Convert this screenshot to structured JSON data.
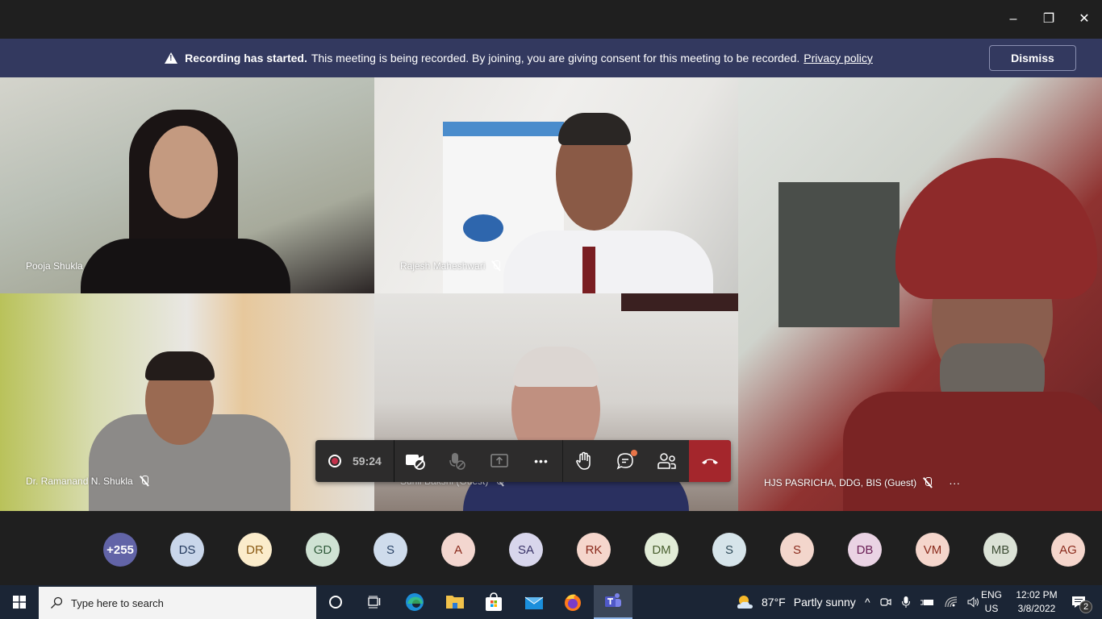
{
  "window": {
    "controls": {
      "minimize": "–",
      "restore": "❐",
      "close": "✕"
    }
  },
  "banner": {
    "icon": "warning-icon",
    "bold": "Recording has started.",
    "text": "This meeting is being recorded. By joining, you are giving consent for this meeting to be recorded.",
    "link": "Privacy policy",
    "dismiss": "Dismiss"
  },
  "participants": [
    {
      "name": "Pooja Shukla",
      "muted": false
    },
    {
      "name": "Rajesh Maheshwari",
      "muted": true
    },
    {
      "name": "Dr. Ramanand N. Shukla",
      "muted": true
    },
    {
      "name": "Sunil Bakshi (Guest)",
      "muted": true
    },
    {
      "name": "HJS PASRICHA, DDG, BIS (Guest)",
      "muted": true,
      "more": "···"
    }
  ],
  "toolbar": {
    "recording": true,
    "timer": "59:24",
    "buttons": [
      "camera-off",
      "mic-off",
      "share-screen",
      "more-actions",
      "raise-hand",
      "chat",
      "participants",
      "leave"
    ],
    "more_label": "•••",
    "chat_unread": true
  },
  "roster": {
    "overflow": {
      "label": "+255",
      "bg": "#6264a7",
      "fg": "#ffffff"
    },
    "avatars": [
      {
        "initials": "DS",
        "bg": "#c9d6ea",
        "fg": "#243a5e"
      },
      {
        "initials": "DR",
        "bg": "#fbeccb",
        "fg": "#8a5a14"
      },
      {
        "initials": "GD",
        "bg": "#cfe2d3",
        "fg": "#2f5a3a"
      },
      {
        "initials": "S",
        "bg": "#cfdcec",
        "fg": "#2b4466"
      },
      {
        "initials": "A",
        "bg": "#f3d6cf",
        "fg": "#8a2a1c"
      },
      {
        "initials": "SA",
        "bg": "#d8d6ec",
        "fg": "#3a3468"
      },
      {
        "initials": "RK",
        "bg": "#f5d6cc",
        "fg": "#8a2a1c"
      },
      {
        "initials": "DM",
        "bg": "#e2ecd7",
        "fg": "#4a6030"
      },
      {
        "initials": "S",
        "bg": "#d6e4ea",
        "fg": "#2e4a58"
      },
      {
        "initials": "S",
        "bg": "#f3d6cc",
        "fg": "#8a2a1c"
      },
      {
        "initials": "DB",
        "bg": "#ead3e4",
        "fg": "#6a1e55"
      },
      {
        "initials": "VM",
        "bg": "#f5d6cc",
        "fg": "#8a2a1c"
      },
      {
        "initials": "MB",
        "bg": "#dbe2d6",
        "fg": "#3e4e36"
      },
      {
        "initials": "AG",
        "bg": "#f5d6cc",
        "fg": "#8a2a1c"
      }
    ]
  },
  "taskbar": {
    "search_placeholder": "Type here to search",
    "apps": [
      "cortana",
      "task-view",
      "edge",
      "file-explorer",
      "store",
      "mail",
      "firefox",
      "teams"
    ],
    "weather": {
      "temp": "87°F",
      "condition": "Partly sunny"
    },
    "language": {
      "line1": "ENG",
      "line2": "US"
    },
    "time": "12:02 PM",
    "date": "3/8/2022",
    "notifications": "2"
  }
}
